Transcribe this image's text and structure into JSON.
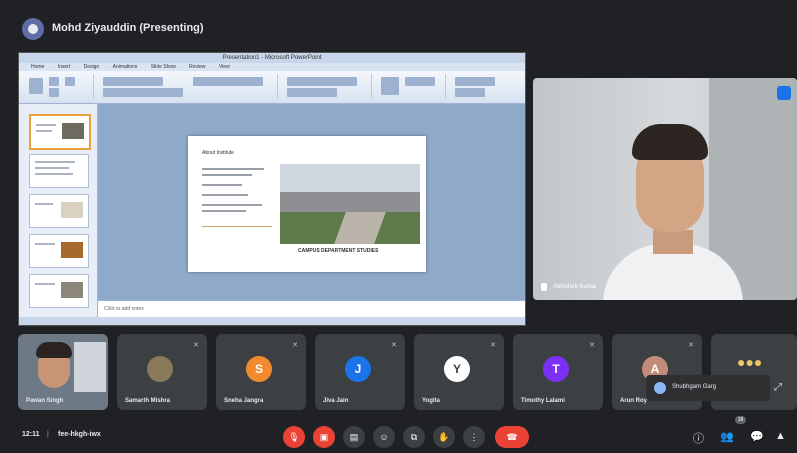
{
  "header": {
    "presenting_label": "Mohd Ziyauddin (Presenting)"
  },
  "shared_screen": {
    "ppt_window_title": "Presentation1 - Microsoft PowerPoint",
    "ppt_tabs": [
      "Home",
      "Insert",
      "Design",
      "Animations",
      "Slide Show",
      "Review",
      "View"
    ],
    "slide": {
      "heading": "About Institute",
      "caption": "CAMPUS DEPARTMENT STUDIES"
    },
    "notes_placeholder": "Click to add notes"
  },
  "speaker": {
    "name": "Abhishek Kumar"
  },
  "participants": [
    {
      "name": "Pawan Singh",
      "type": "video"
    },
    {
      "name": "Samarth Mishra",
      "initial": "",
      "color": "#8a7a5a"
    },
    {
      "name": "Sneha Jangra",
      "initial": "S",
      "color": "#f28b30"
    },
    {
      "name": "Jiva Jain",
      "initial": "J",
      "color": "#1a73e8"
    },
    {
      "name": "Yogita",
      "initial": "Y",
      "color": "#ffffff"
    },
    {
      "name": "Timothy Lalami",
      "initial": "T",
      "color": "#7b2ff7"
    },
    {
      "name": "Arun Roy",
      "initial": "A",
      "color": "#c38b7a"
    }
  ],
  "others": {
    "label": "Shubhgam Garg"
  },
  "controls": {
    "time": "12:11",
    "separator": "|",
    "meeting_code": "fee-hkgh-iwx",
    "people_count": "18"
  }
}
